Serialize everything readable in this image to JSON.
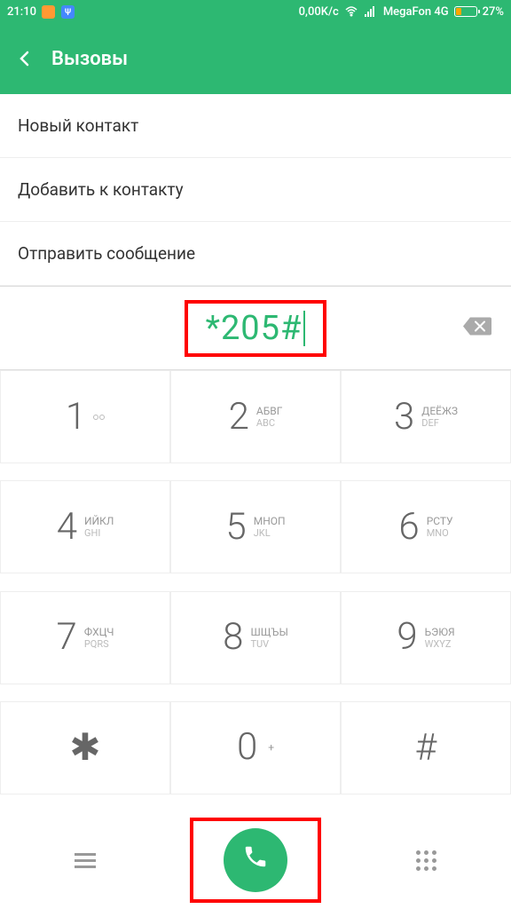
{
  "status": {
    "time": "21:10",
    "speed": "0,00K/c",
    "carrier": "MegaFon 4G",
    "battery": "27%"
  },
  "header": {
    "title": "Вызовы"
  },
  "menu": {
    "new_contact": "Новый контакт",
    "add_to_contact": "Добавить к контакту",
    "send_message": "Отправить сообщение"
  },
  "dialed": "*205#",
  "keypad": [
    {
      "digit": "1",
      "top": "",
      "bottom": ""
    },
    {
      "digit": "2",
      "top": "АБВГ",
      "bottom": "ABC"
    },
    {
      "digit": "3",
      "top": "ДЕЁЖЗ",
      "bottom": "DEF"
    },
    {
      "digit": "4",
      "top": "ИЙКЛ",
      "bottom": "GHI"
    },
    {
      "digit": "5",
      "top": "МНОП",
      "bottom": "JKL"
    },
    {
      "digit": "6",
      "top": "РСТУ",
      "bottom": "MNO"
    },
    {
      "digit": "7",
      "top": "ФХЦЧ",
      "bottom": "PQRS"
    },
    {
      "digit": "8",
      "top": "ШЩЪЫ",
      "bottom": "TUV"
    },
    {
      "digit": "9",
      "top": "ЬЭЮЯ",
      "bottom": "WXYZ"
    },
    {
      "digit": "✱",
      "top": "",
      "bottom": ""
    },
    {
      "digit": "0",
      "top": "+",
      "bottom": ""
    },
    {
      "digit": "#",
      "top": "",
      "bottom": ""
    }
  ]
}
